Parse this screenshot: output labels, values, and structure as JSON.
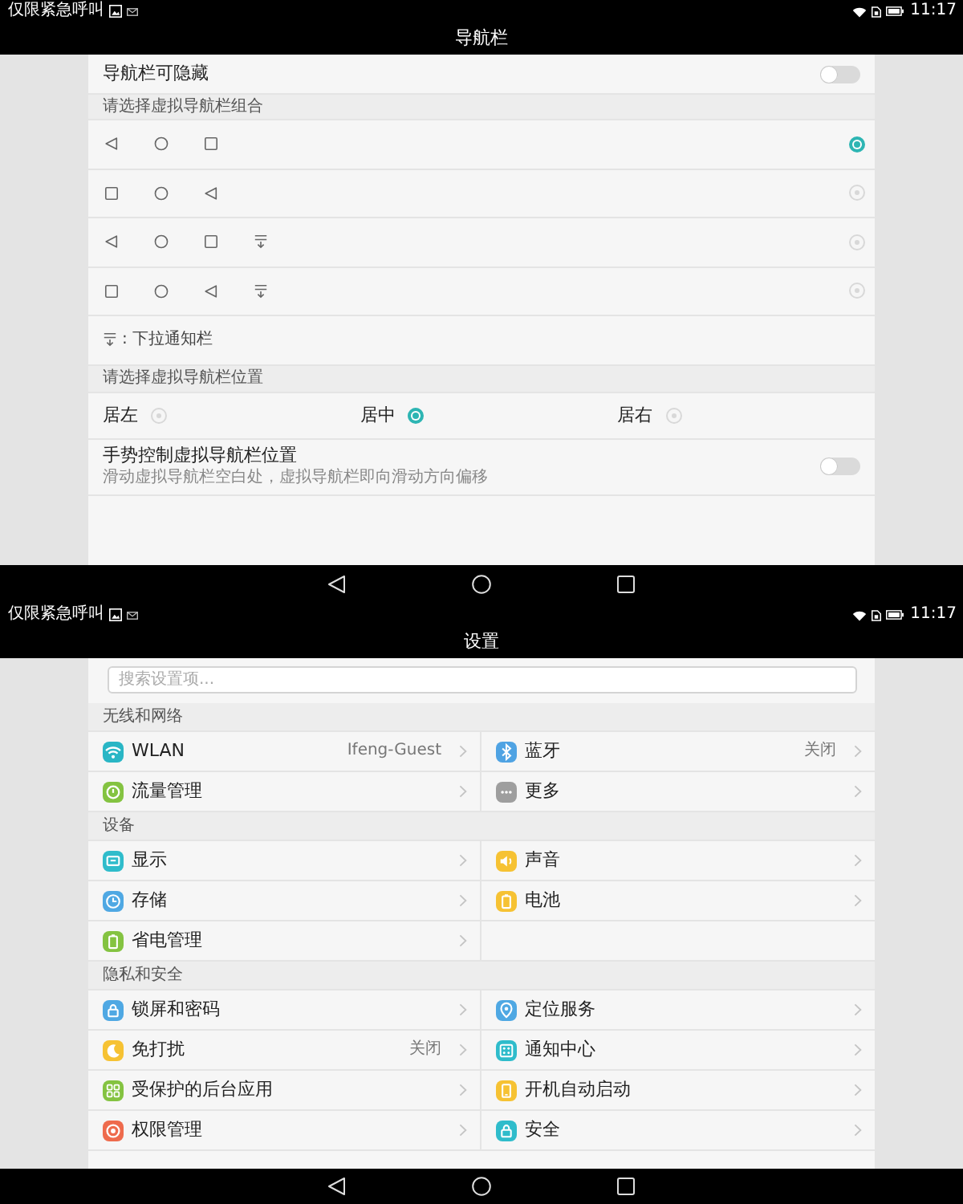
{
  "nav_screen": {
    "status_bar": {
      "carrier": "仅限紧急呼叫",
      "time": "11:17"
    },
    "title": "导航栏",
    "hide_option": {
      "label": "导航栏可隐藏",
      "on": false
    },
    "combo_header": "请选择虚拟导航栏组合",
    "combos": [
      {
        "keys": [
          {
            "kind": "back"
          },
          {
            "kind": "home"
          },
          {
            "kind": "recent"
          }
        ],
        "selected": true
      },
      {
        "keys": [
          {
            "kind": "recent"
          },
          {
            "kind": "home"
          },
          {
            "kind": "back"
          }
        ],
        "selected": false
      },
      {
        "keys": [
          {
            "kind": "back"
          },
          {
            "kind": "home"
          },
          {
            "kind": "recent"
          },
          {
            "kind": "pulldown"
          }
        ],
        "selected": false
      },
      {
        "keys": [
          {
            "kind": "recent"
          },
          {
            "kind": "home"
          },
          {
            "kind": "back"
          },
          {
            "kind": "pulldown"
          }
        ],
        "selected": false
      }
    ],
    "legend": {
      "kind": "pulldown",
      "text": ": 下拉通知栏"
    },
    "position_header": "请选择虚拟导航栏位置",
    "positions": [
      {
        "label": "居左",
        "selected": false
      },
      {
        "label": "居中",
        "selected": true
      },
      {
        "label": "居右",
        "selected": false
      }
    ],
    "gesture": {
      "title": "手势控制虚拟导航栏位置",
      "subtitle": "滑动虚拟导航栏空白处，虚拟导航栏即向滑动方向偏移",
      "on": false
    },
    "nav_bar": {
      "keys": [
        {
          "kind": "back"
        },
        {
          "kind": "home"
        },
        {
          "kind": "recent"
        }
      ]
    }
  },
  "settings_screen": {
    "status_bar": {
      "carrier": "仅限紧急呼叫",
      "time": "11:17"
    },
    "title": "设置",
    "search": {
      "placeholder": "搜索设置项..."
    },
    "sections": [
      {
        "title": "无线和网络",
        "items": [
          {
            "label": "WLAN",
            "value": "Ifeng-Guest",
            "color": "#29b6c5"
          },
          {
            "label": "蓝牙",
            "value": "关闭",
            "color": "#4fa3e3"
          },
          {
            "label": "流量管理",
            "color": "#84c341"
          },
          {
            "label": "更多",
            "color": "#9e9e9e"
          }
        ]
      },
      {
        "title": "设备",
        "items": [
          {
            "label": "显示",
            "color": "#2fbccb"
          },
          {
            "label": "声音",
            "color": "#f6c233"
          },
          {
            "label": "存储",
            "color": "#4fa8e3"
          },
          {
            "label": "电池",
            "color": "#f6c233"
          },
          {
            "label": "省电管理",
            "color": "#84c341"
          }
        ]
      },
      {
        "title": "隐私和安全",
        "items": [
          {
            "label": "锁屏和密码",
            "color": "#4fa8e3"
          },
          {
            "label": "定位服务",
            "color": "#4fa8e3"
          },
          {
            "label": "免打扰",
            "value": "关闭",
            "color": "#f6c233"
          },
          {
            "label": "通知中心",
            "color": "#2fbccb"
          },
          {
            "label": "受保护的后台应用",
            "color": "#84c341"
          },
          {
            "label": "开机自动启动",
            "color": "#f6c233"
          },
          {
            "label": "权限管理",
            "color": "#ee6b4d"
          },
          {
            "label": "安全",
            "color": "#2fbccb"
          }
        ]
      }
    ],
    "nav_bar": {
      "keys": [
        {
          "kind": "back"
        },
        {
          "kind": "home"
        },
        {
          "kind": "recent"
        }
      ]
    }
  }
}
